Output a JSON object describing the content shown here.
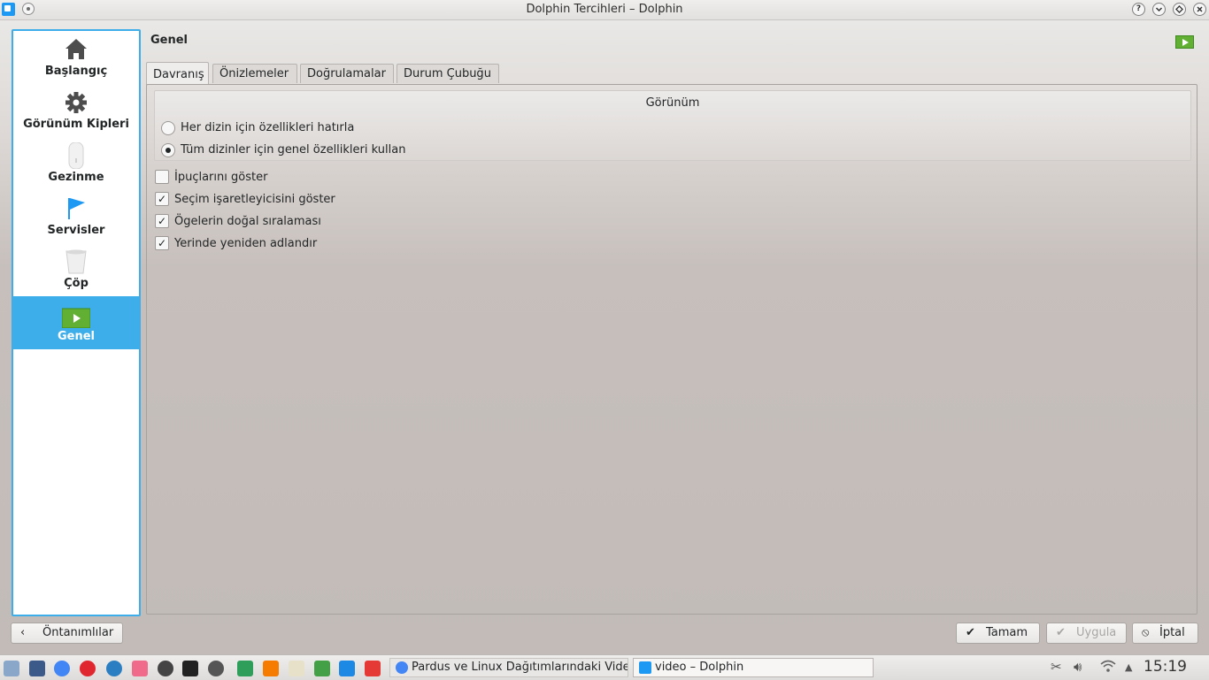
{
  "window": {
    "title": "Dolphin Tercihleri – Dolphin",
    "help": "?"
  },
  "sidebar": {
    "items": [
      {
        "label": "Başlangıç",
        "icon": "home-icon"
      },
      {
        "label": "Görünüm Kipleri",
        "icon": "gear-icon"
      },
      {
        "label": "Gezinme",
        "icon": "mouse-icon"
      },
      {
        "label": "Servisler",
        "icon": "flag-icon"
      },
      {
        "label": "Çöp",
        "icon": "trash-icon"
      },
      {
        "label": "Genel",
        "icon": "green-play-icon",
        "selected": true
      }
    ]
  },
  "page": {
    "title": "Genel"
  },
  "tabs": [
    {
      "label": "Davranış",
      "active": true
    },
    {
      "label": "Önizlemeler"
    },
    {
      "label": "Doğrulamalar"
    },
    {
      "label": "Durum Çubuğu"
    }
  ],
  "group": {
    "title": "Görünüm",
    "radios": [
      {
        "label": "Her dizin için özellikleri hatırla",
        "checked": false
      },
      {
        "label": "Tüm dizinler için genel özellikleri kullan",
        "checked": true
      }
    ]
  },
  "checkboxes": [
    {
      "label": "İpuçlarını göster",
      "checked": false
    },
    {
      "label": "Seçim işaretleyicisini göster",
      "checked": true
    },
    {
      "label": "Ögelerin doğal sıralaması",
      "checked": true
    },
    {
      "label": "Yerinde yeniden adlandır",
      "checked": true
    }
  ],
  "buttons": {
    "defaults": "Öntanımlılar",
    "ok": "Tamam",
    "apply": "Uygula",
    "cancel": "İptal"
  },
  "taskbar": {
    "tasks": [
      {
        "label": "Pardus ve Linux Dağıtımlarındaki Vide"
      },
      {
        "label": "video – Dolphin"
      }
    ],
    "clock": "15:19"
  },
  "colors": {
    "accent": "#3daee9",
    "green": "#62b033"
  }
}
